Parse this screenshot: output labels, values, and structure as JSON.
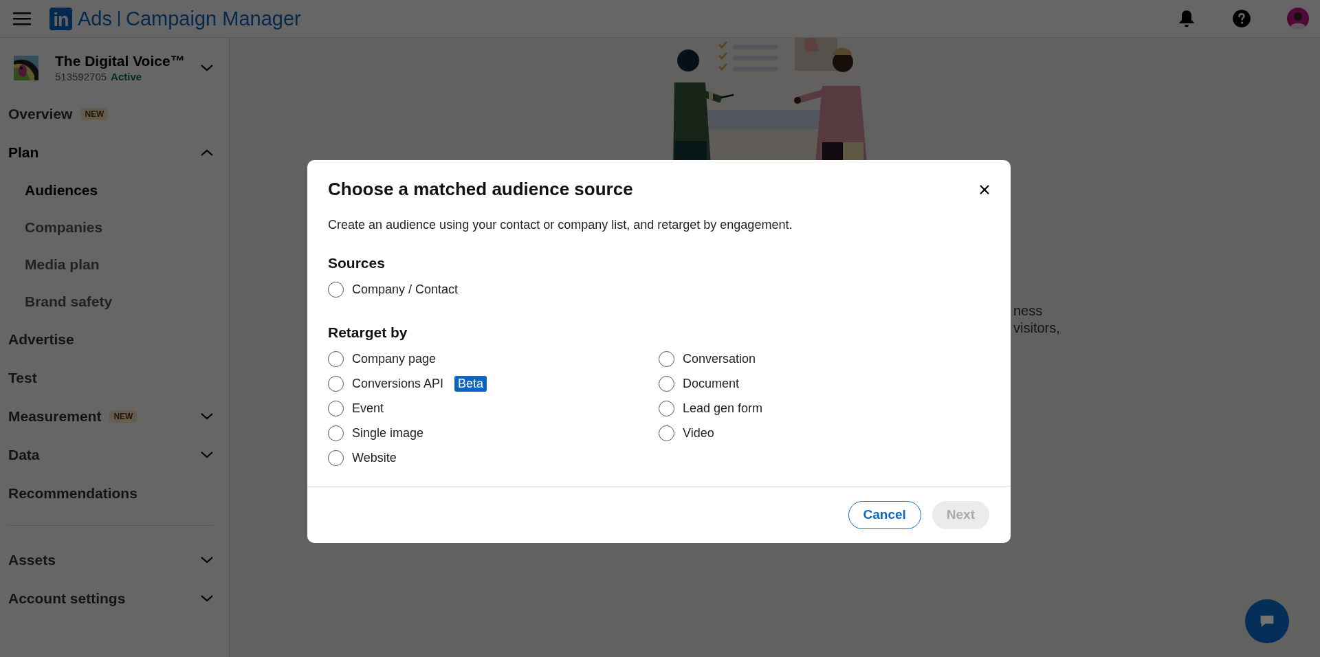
{
  "header": {
    "logo_mark": "in",
    "product": "Ads",
    "title": "Campaign Manager"
  },
  "account": {
    "name": "The Digital Voice™",
    "id": "513592705",
    "status": "Active",
    "expanded": false
  },
  "nav_groups": [
    [
      {
        "label": "Overview",
        "badge": "NEW"
      },
      {
        "label": "Plan",
        "expanded": true,
        "children": [
          {
            "label": "Audiences",
            "selected": true
          },
          {
            "label": "Companies",
            "selected": false
          },
          {
            "label": "Media plan",
            "selected": false
          },
          {
            "label": "Brand safety",
            "selected": false
          }
        ]
      },
      {
        "label": "Advertise"
      },
      {
        "label": "Test"
      },
      {
        "label": "Measurement",
        "badge": "NEW",
        "expanded": false
      },
      {
        "label": "Data",
        "expanded": false
      },
      {
        "label": "Recommendations"
      }
    ],
    [
      {
        "label": "Assets",
        "expanded": false
      },
      {
        "label": "Account settings",
        "expanded": false
      }
    ]
  ],
  "background_text": [
    "ness",
    "visitors,"
  ],
  "modal": {
    "title": "Choose a matched audience source",
    "description": "Create an audience using your contact or company list, and retarget by engagement.",
    "sections": [
      {
        "heading": "Sources",
        "columns": [
          [
            {
              "label": "Company / Contact",
              "selected": false
            }
          ]
        ]
      },
      {
        "heading": "Retarget by",
        "columns": [
          [
            {
              "label": "Company page",
              "selected": false
            },
            {
              "label": "Conversions API",
              "badge": "Beta",
              "selected": false
            },
            {
              "label": "Event",
              "selected": false
            },
            {
              "label": "Single image",
              "selected": false
            },
            {
              "label": "Website",
              "selected": false
            }
          ],
          [
            {
              "label": "Conversation",
              "selected": false
            },
            {
              "label": "Document",
              "selected": false
            },
            {
              "label": "Lead gen form",
              "selected": false
            },
            {
              "label": "Video",
              "selected": false
            }
          ]
        ]
      }
    ],
    "buttons": [
      {
        "label": "Cancel",
        "kind": "secondary",
        "disabled": false
      },
      {
        "label": "Next",
        "kind": "primary",
        "disabled": true
      }
    ]
  }
}
